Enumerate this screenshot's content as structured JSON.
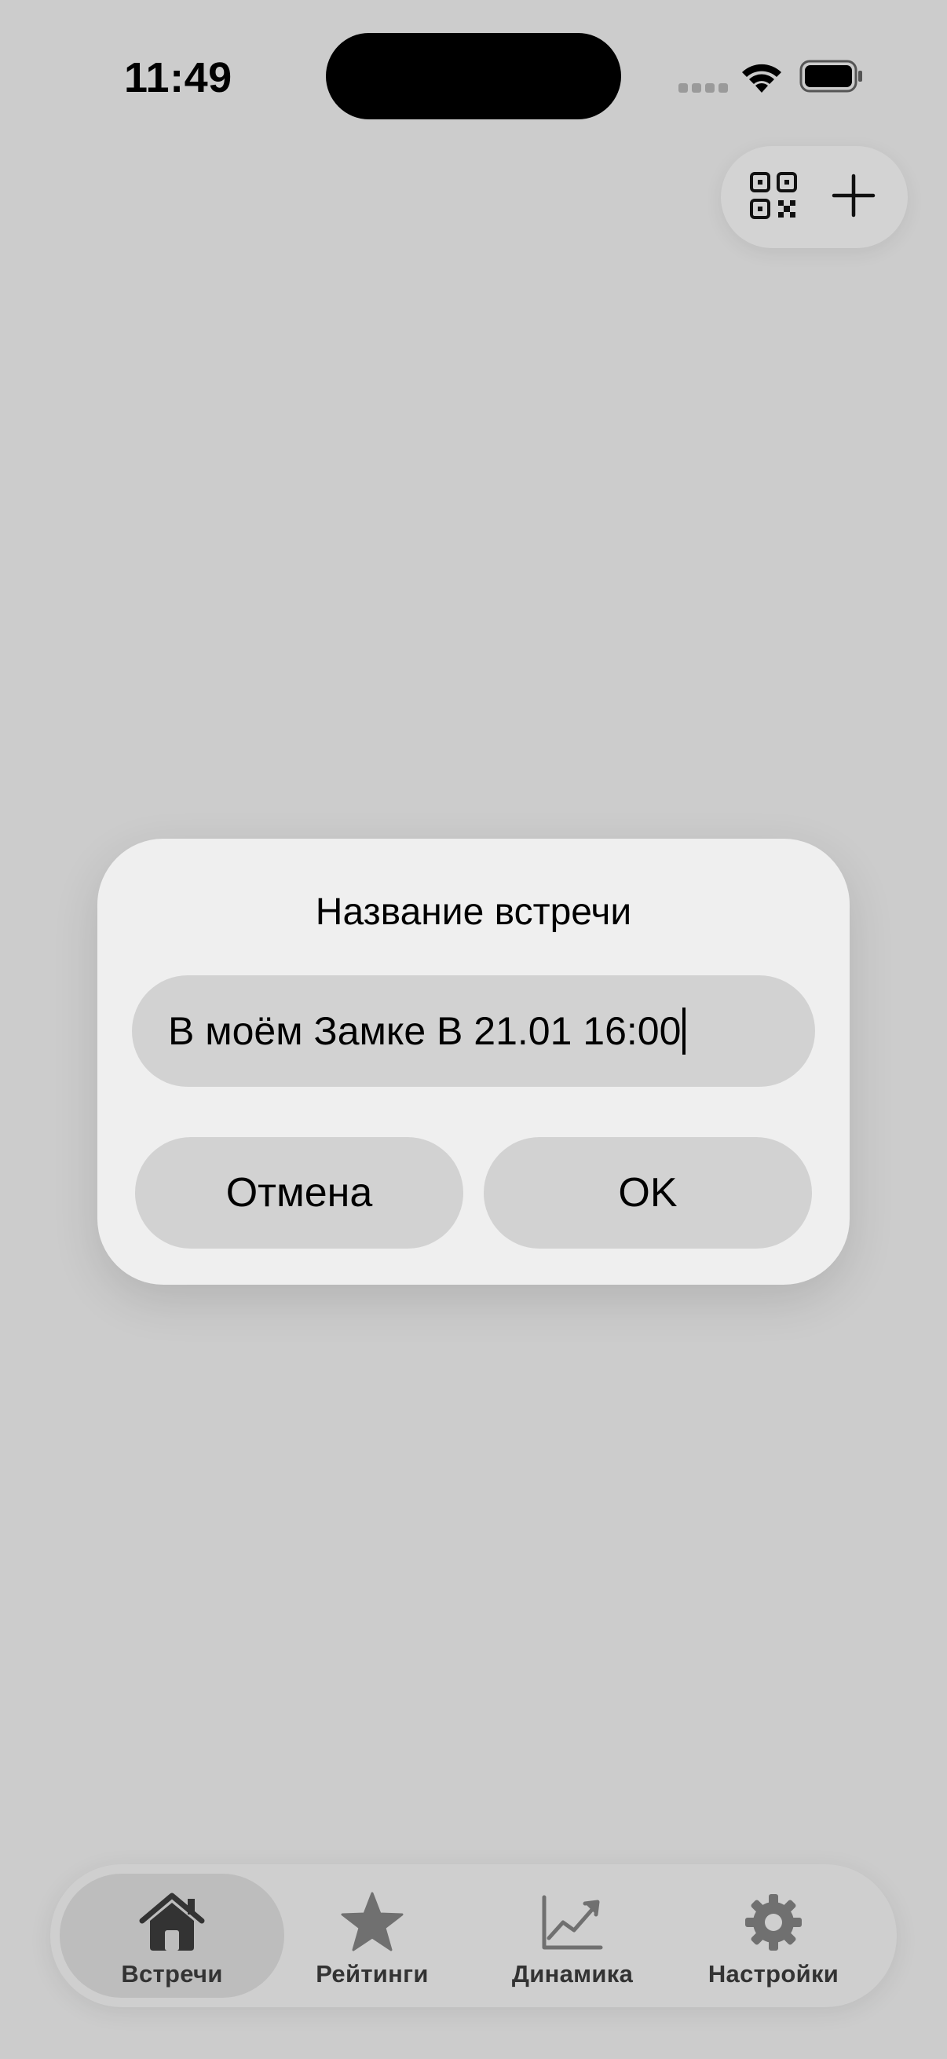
{
  "status_bar": {
    "time": "11:49"
  },
  "top_actions": {
    "qr_icon": "qr-code-icon",
    "add_icon": "plus-icon"
  },
  "dialog": {
    "title": "Название встречи",
    "input_value": "В моём Замке В 21.01 16:00",
    "cancel_label": "Отмена",
    "ok_label": "OK"
  },
  "tab_bar": {
    "tabs": [
      {
        "label": "Встречи",
        "icon": "house-icon",
        "active": true
      },
      {
        "label": "Рейтинги",
        "icon": "star-icon",
        "active": false
      },
      {
        "label": "Динамика",
        "icon": "chart-line-icon",
        "active": false
      },
      {
        "label": "Настройки",
        "icon": "gear-icon",
        "active": false
      }
    ]
  },
  "colors": {
    "background": "#cccccc",
    "dialog": "#efefef",
    "control": "#d2d2d2",
    "tab_active": "#bdbdbd"
  }
}
